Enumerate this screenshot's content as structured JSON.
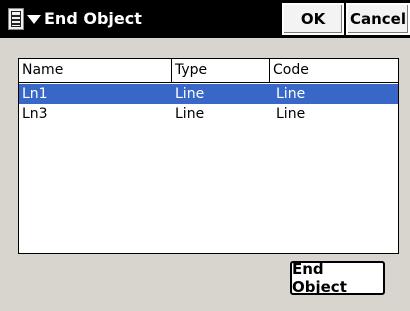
{
  "window": {
    "title": "End Object",
    "menu_icon": "menu-icon",
    "ok_label": "OK",
    "cancel_label": "Cancel"
  },
  "list": {
    "columns": [
      "Name",
      "Type",
      "Code"
    ],
    "rows": [
      {
        "name": "Ln1",
        "type": "Line",
        "code": "Line",
        "selected": true
      },
      {
        "name": "Ln3",
        "type": "Line",
        "code": "Line",
        "selected": false
      }
    ]
  },
  "actions": {
    "end_object_label": "End Object"
  },
  "colors": {
    "titlebar": "#000000",
    "selection": "#3867c8",
    "dialog_bg": "#d8d5ce"
  }
}
